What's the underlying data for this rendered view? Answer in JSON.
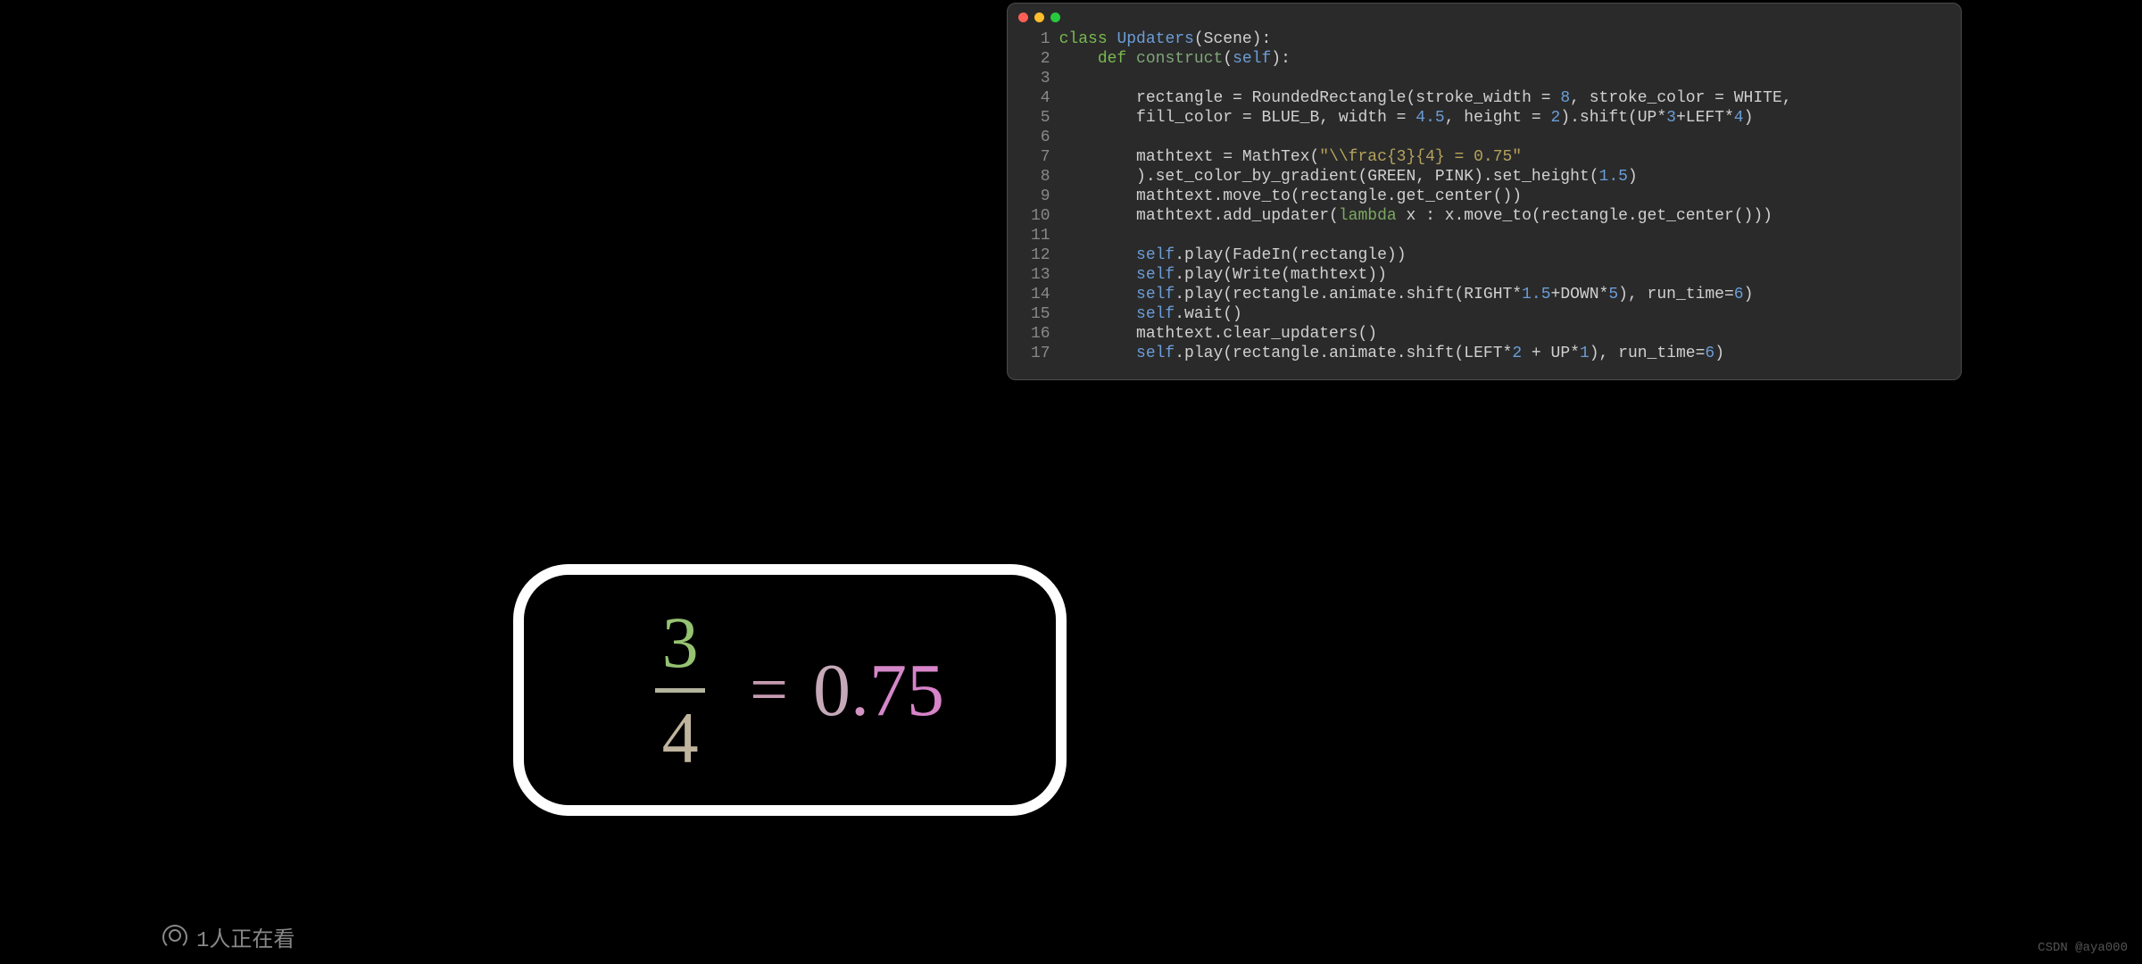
{
  "code": {
    "line_numbers": [
      "1",
      "2",
      "3",
      "4",
      "5",
      "6",
      "7",
      "8",
      "9",
      "10",
      "11",
      "12",
      "13",
      "14",
      "15",
      "16",
      "17"
    ],
    "tokens": {
      "class_kw": "class",
      "class_name": "Updaters",
      "scene": "(Scene):",
      "def_kw": "def",
      "construct": "construct",
      "self": "self",
      "paren_colon": "):",
      "line4_a": "        rectangle = RoundedRectangle(stroke_width = ",
      "line4_n1": "8",
      "line4_b": ", stroke_color = WHITE,",
      "line5_a": "        fill_color = BLUE_B, width = ",
      "line5_n1": "4.5",
      "line5_b": ", height = ",
      "line5_n2": "2",
      "line5_c": ").shift(UP*",
      "line5_n3": "3",
      "line5_d": "+LEFT*",
      "line5_n4": "4",
      "line5_e": ")",
      "line7_a": "        mathtext = MathTex(",
      "line7_s": "\"\\\\frac{3}{4} = 0.75\"",
      "line8_a": "        ).set_color_by_gradient(GREEN, PINK).set_height(",
      "line8_n1": "1.5",
      "line8_b": ")",
      "line9": "        mathtext.move_to(rectangle.get_center())",
      "line10_a": "        mathtext.add_updater(",
      "line10_lambda": "lambda",
      "line10_b": " x : x.move_to(rectangle.get_center()))",
      "line12_a": ".play(FadeIn(rectangle))",
      "line13_a": ".play(Write(mathtext))",
      "line14_a": ".play(rectangle.animate.shift(RIGHT*",
      "line14_n1": "1.5",
      "line14_b": "+DOWN*",
      "line14_n2": "5",
      "line14_c": "), run_time=",
      "line14_n3": "6",
      "line14_d": ")",
      "line15_a": ".wait()",
      "line16": "        mathtext.clear_updaters()",
      "line17_a": ".play(rectangle.animate.shift(LEFT*",
      "line17_n1": "2",
      "line17_b": " + UP*",
      "line17_n2": "1",
      "line17_c": "), run_time=",
      "line17_n3": "6",
      "line17_d": ")",
      "indent8": "        ",
      "open_paren": "(",
      "indent4": "    "
    }
  },
  "math": {
    "numerator": "3",
    "denominator": "4",
    "equals": "=",
    "d0": "0",
    "ddot": ".",
    "d7": "7",
    "d5": "5"
  },
  "footer": {
    "viewer_text": "1人正在看",
    "watermark": "CSDN @aya000"
  }
}
